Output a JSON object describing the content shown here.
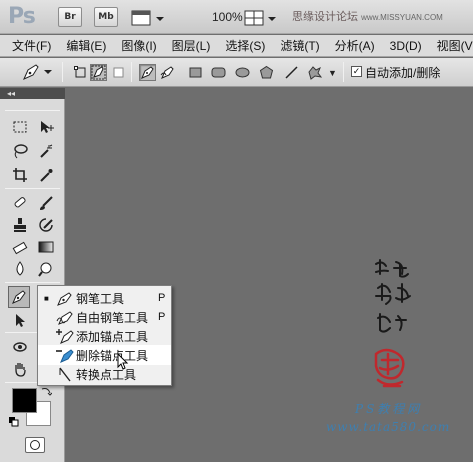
{
  "app": {
    "logo": "Ps",
    "bridge_label": "Br",
    "minibridge_label": "Mb",
    "zoom": "100%"
  },
  "watermark_top": {
    "text": "思缘设计论坛",
    "url": "www.MISSYUAN.COM"
  },
  "menu": [
    "文件(F)",
    "编辑(E)",
    "图像(I)",
    "图层(L)",
    "选择(S)",
    "滤镜(T)",
    "分析(A)",
    "3D(D)",
    "视图(V"
  ],
  "options": {
    "auto_add_delete_label": "自动添加/删除",
    "auto_add_delete_checked": true,
    "check_mark": "✓"
  },
  "toolbox": {
    "collapse_label": "◂◂"
  },
  "flyout": {
    "items": [
      {
        "label": "钢笔工具",
        "key": "P",
        "active": true,
        "icon": "pen-icon"
      },
      {
        "label": "自由钢笔工具",
        "key": "P",
        "active": false,
        "icon": "freeform-pen-icon"
      },
      {
        "label": "添加锚点工具",
        "key": "",
        "active": false,
        "icon": "add-anchor-icon"
      },
      {
        "label": "删除锚点工具",
        "key": "",
        "active": false,
        "icon": "delete-anchor-icon"
      },
      {
        "label": "转换点工具",
        "key": "",
        "active": false,
        "icon": "convert-point-icon"
      }
    ],
    "bullet": "■"
  },
  "canvas": {
    "watermark_cn": "PS教程网",
    "watermark_url": "www.tata580.com",
    "bg_color": "#6e6e6e"
  }
}
